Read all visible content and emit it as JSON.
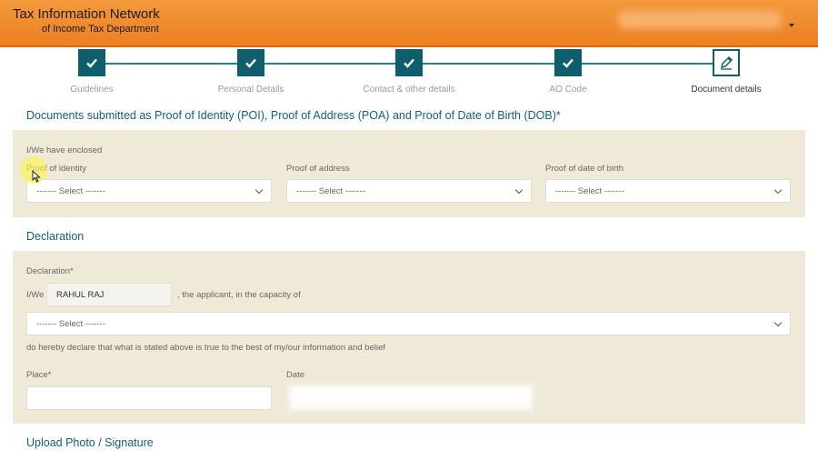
{
  "header": {
    "title_line1": "Tax Information Network",
    "title_line2": "of Income Tax Department"
  },
  "stepper": {
    "steps": [
      {
        "label": "Guidelines",
        "status": "complete",
        "icon": "check-icon"
      },
      {
        "label": "Personal Details",
        "status": "complete",
        "icon": "check-icon"
      },
      {
        "label": "Contact & other details",
        "status": "complete",
        "icon": "check-icon"
      },
      {
        "label": "AO Code",
        "status": "complete",
        "icon": "check-icon"
      },
      {
        "label": "Document details",
        "status": "current",
        "icon": "edit-icon"
      }
    ]
  },
  "documents": {
    "title": "Documents submitted as Proof of Identity (POI), Proof of Address (POA) and Proof of Date of Birth (DOB)*",
    "enclosed_label": "I/We have enclosed",
    "poi_label": "Proof of identity",
    "poa_label": "Proof of address",
    "dob_label": "Proof of date of birth",
    "poi_value": "------- Select -------",
    "poa_value": "------- Select -------",
    "dob_value": "------- Select -------"
  },
  "declaration": {
    "title": "Declaration",
    "field_label": "Declaration*",
    "iwe_label": "I/We",
    "name_value": "RAHUL RAJ",
    "capacity_text": ", the applicant, in the capacity of",
    "capacity_value": "------- Select -------",
    "declare_text": "do hereby declare that what is stated above is true to the best of my/our information and belief",
    "place_label": "Place*",
    "place_value": "",
    "date_label": "Date"
  },
  "upload": {
    "title": "Upload Photo / Signature"
  },
  "colors": {
    "header_orange": "#ec7f22",
    "step_teal": "#0f5e6d",
    "section_title": "#135e78",
    "panel_bg": "#efe9d8"
  }
}
